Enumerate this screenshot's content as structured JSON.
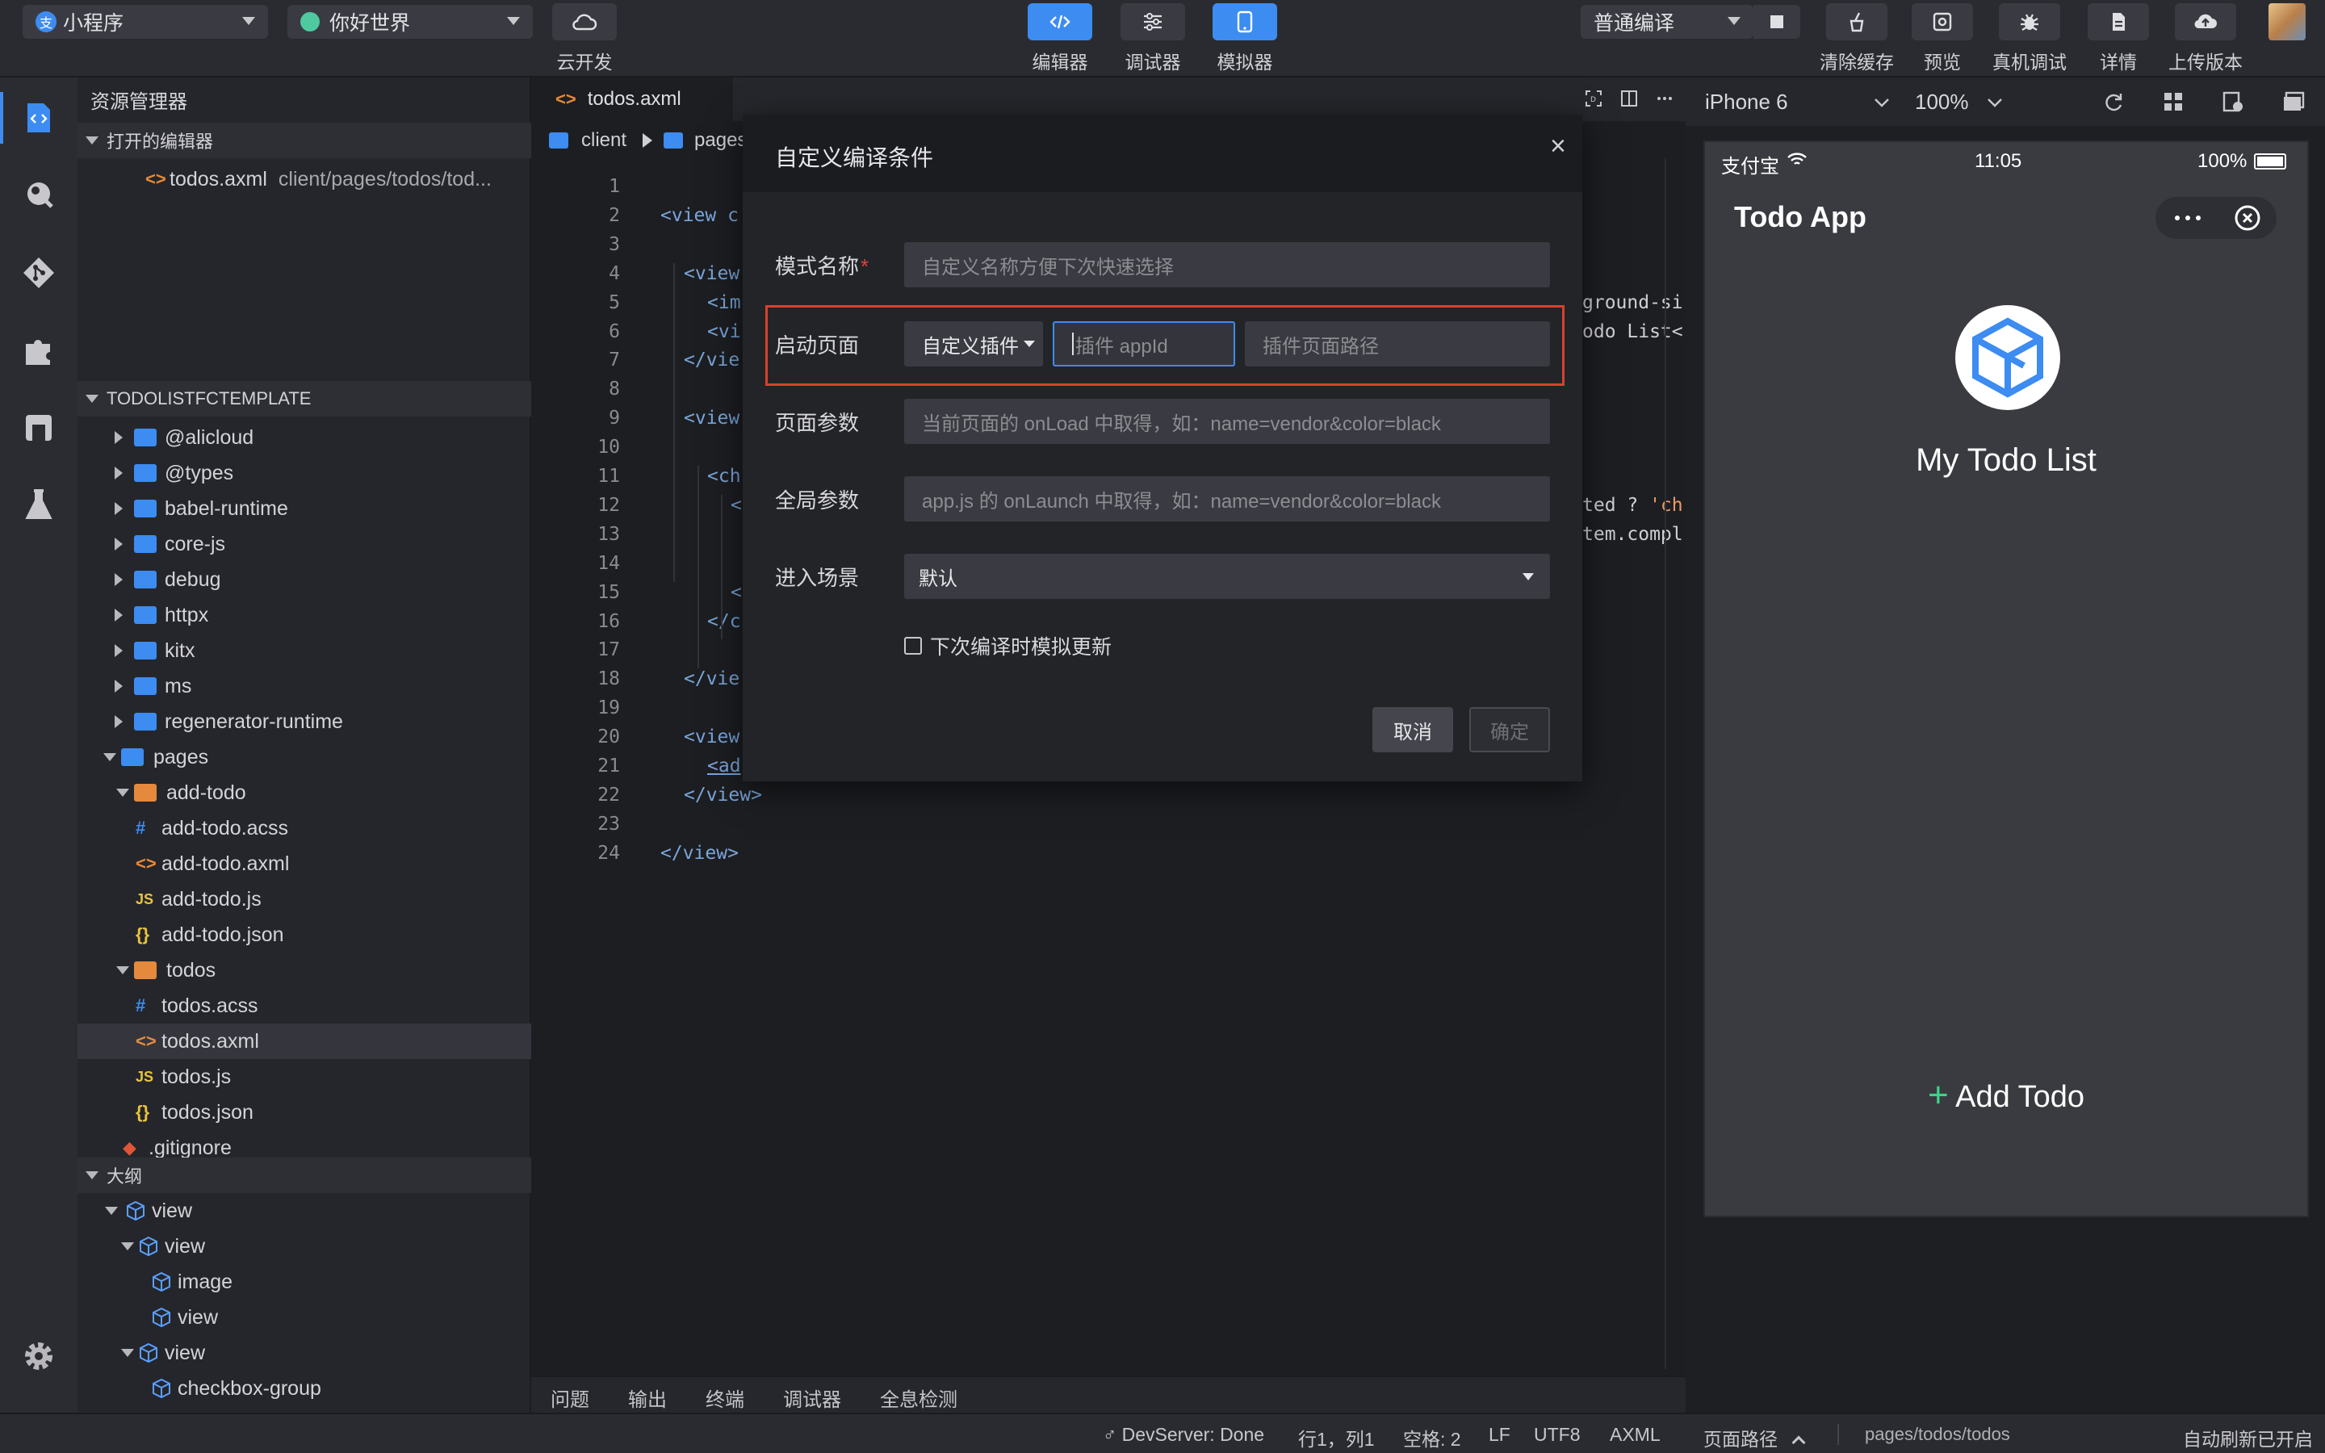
{
  "toolbar": {
    "project_type": "小程序",
    "project_name": "你好世界",
    "cloud_label": "云开发",
    "editor_label": "编辑器",
    "debugger_label": "调试器",
    "simulator_label": "模拟器",
    "compile_mode": "普通编译",
    "clear_cache_label": "清除缓存",
    "preview_label": "预览",
    "device_debug_label": "真机调试",
    "details_label": "详情",
    "upload_label": "上传版本"
  },
  "explorer": {
    "title": "资源管理器",
    "open_editors": "打开的编辑器",
    "open_file": "todos.axml",
    "open_file_path": "client/pages/todos/tod...",
    "project_root": "TODOLISTFCTEMPLATE",
    "items": [
      {
        "label": "@alicloud",
        "type": "folder"
      },
      {
        "label": "@types",
        "type": "folder"
      },
      {
        "label": "babel-runtime",
        "type": "folder"
      },
      {
        "label": "core-js",
        "type": "folder"
      },
      {
        "label": "debug",
        "type": "folder"
      },
      {
        "label": "httpx",
        "type": "folder"
      },
      {
        "label": "kitx",
        "type": "folder"
      },
      {
        "label": "ms",
        "type": "folder"
      },
      {
        "label": "regenerator-runtime",
        "type": "folder"
      },
      {
        "label": "pages",
        "type": "folder-open"
      },
      {
        "label": "add-todo",
        "type": "folder-open"
      },
      {
        "label": "add-todo.acss",
        "type": "acss"
      },
      {
        "label": "add-todo.axml",
        "type": "axml"
      },
      {
        "label": "add-todo.js",
        "type": "js"
      },
      {
        "label": "add-todo.json",
        "type": "json"
      },
      {
        "label": "todos",
        "type": "folder-open"
      },
      {
        "label": "todos.acss",
        "type": "acss"
      },
      {
        "label": "todos.axml",
        "type": "axml"
      },
      {
        "label": "todos.js",
        "type": "js"
      },
      {
        "label": "todos.json",
        "type": "json"
      },
      {
        "label": ".gitignore",
        "type": "git"
      }
    ],
    "outline_title": "大纲",
    "outline": [
      "view",
      "view",
      "image",
      "view",
      "view",
      "checkbox-group"
    ]
  },
  "editor": {
    "tab": "todos.axml",
    "breadcrumb": [
      "client",
      "pages"
    ],
    "line_numbers": [
      "1",
      "2",
      "3",
      "4",
      "5",
      "6",
      "7",
      "8",
      "9",
      "10",
      "11",
      "12",
      "13",
      "14",
      "15",
      "16",
      "17",
      "18",
      "19",
      "20",
      "21",
      "22",
      "23",
      "24"
    ],
    "code": {
      "l2": "<view c",
      "l4": "<view",
      "l5": "<im",
      "l6": "<vi",
      "l7": "</vie",
      "l9": "<view",
      "l11": "<ch",
      "l12": "<",
      "l15": "<",
      "l16": "</c",
      "l18": "</vie",
      "l20": "<view",
      "l21": "<ad",
      "l22": "</view>",
      "l24": "</view>",
      "r5": "ground-si",
      "r6": "odo List<",
      "r12a": "ted ? ",
      "r12b": "'ch",
      "r13": "tem.compl"
    }
  },
  "bottom_tabs": [
    "问题",
    "输出",
    "终端",
    "调试器",
    "全息检测"
  ],
  "statusbar": {
    "devserver": "DevServer: Done",
    "position": "行1，列1",
    "spaces": "空格: 2",
    "eol": "LF",
    "encoding": "UTF8",
    "language": "AXML",
    "page_path_label": "页面路径",
    "page_path": "pages/todos/todos",
    "auto_refresh": "自动刷新已开启"
  },
  "simulator": {
    "device": "iPhone 6",
    "zoom": "100%",
    "carrier": "支付宝",
    "time": "11:05",
    "battery": "100%",
    "app_title": "Todo App",
    "heading": "My Todo List",
    "add_todo": "Add Todo"
  },
  "modal": {
    "title": "自定义编译条件",
    "close": "×",
    "mode_name_label": "模式名称",
    "required_mark": "*",
    "mode_name_placeholder": "自定义名称方便下次快速选择",
    "launch_page_label": "启动页面",
    "launch_type": "自定义插件",
    "plugin_appid_placeholder": "插件 appId",
    "plugin_path_placeholder": "插件页面路径",
    "page_params_label": "页面参数",
    "page_params_placeholder": "当前页面的 onLoad 中取得，如：name=vendor&color=black",
    "global_params_label": "全局参数",
    "global_params_placeholder": "app.js 的 onLaunch 中取得，如：name=vendor&color=black",
    "scene_label": "进入场景",
    "scene_value": "默认",
    "simulate_update_label": "下次编译时模拟更新",
    "cancel": "取消",
    "confirm": "确定"
  },
  "colors": {
    "accent": "#3c8cf2",
    "highlight_border": "#d6412f",
    "required": "#e04040"
  }
}
